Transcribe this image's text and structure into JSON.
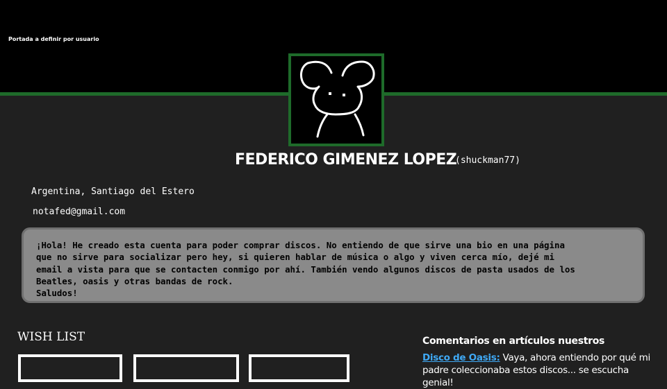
{
  "cover": {
    "label": "Portada a definir por usuario"
  },
  "profile": {
    "avatar_icon": "mouse-doodle-icon",
    "name": "FEDERICO GIMENEZ LOPEZ",
    "username": "(shuckman77)",
    "location": "Argentina, Santiago del Estero",
    "email": "notafed@gmail.com",
    "bio": "¡Hola! He creado esta cuenta para poder comprar discos. No entiendo de que sirve una bio en una página\nque no sirve para socializar pero hey, si quieren hablar de música o algo y viven cerca mío, dejé mi\nemail a vista para que se contacten conmigo por ahí. También vendo algunos discos de pasta usados de los\nBeatles, oasis y otras bandas de rock.\nSaludos!"
  },
  "wishlist": {
    "title": "WISH LIST",
    "items": [
      {},
      {},
      {}
    ]
  },
  "comments": {
    "title": "Comentarios en artículos nuestros",
    "items": [
      {
        "link": "Disco de Oasis:",
        "text": " Vaya, ahora entiendo por qué mi padre coleccionaba estos discos... se escucha genial!"
      }
    ]
  },
  "colors": {
    "background": "#202020",
    "cover": "#000000",
    "accent_green": "#1e6b2a",
    "bio_background": "#8a8a8a",
    "link": "#3fa9f5"
  }
}
